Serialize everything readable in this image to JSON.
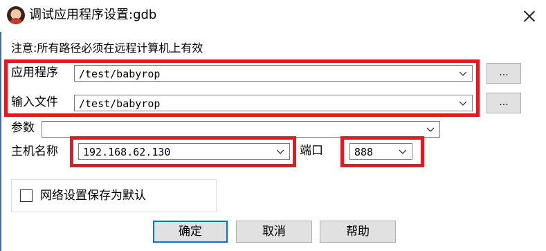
{
  "window": {
    "title": "调试应用程序设置:gdb",
    "icon": "avatar-icon"
  },
  "notice": "注意:所有路径必须在远程计算机上有效",
  "fields": {
    "application": {
      "label": "应用程序",
      "value": "/test/babyrop",
      "browse_label": "..."
    },
    "input_file": {
      "label": "输入文件",
      "value": "/test/babyrop",
      "browse_label": "..."
    },
    "arguments": {
      "label": "参数",
      "value": ""
    },
    "hostname": {
      "label": "主机名称",
      "value": "192.168.62.130"
    },
    "port": {
      "label": "端口",
      "value": "888"
    }
  },
  "save_default": {
    "label": "网络设置保存为默认",
    "checked": false
  },
  "buttons": {
    "ok": "确定",
    "cancel": "取消",
    "help": "帮助"
  },
  "colors": {
    "highlight": "#e01b24",
    "default_button_border": "#0078d7"
  }
}
